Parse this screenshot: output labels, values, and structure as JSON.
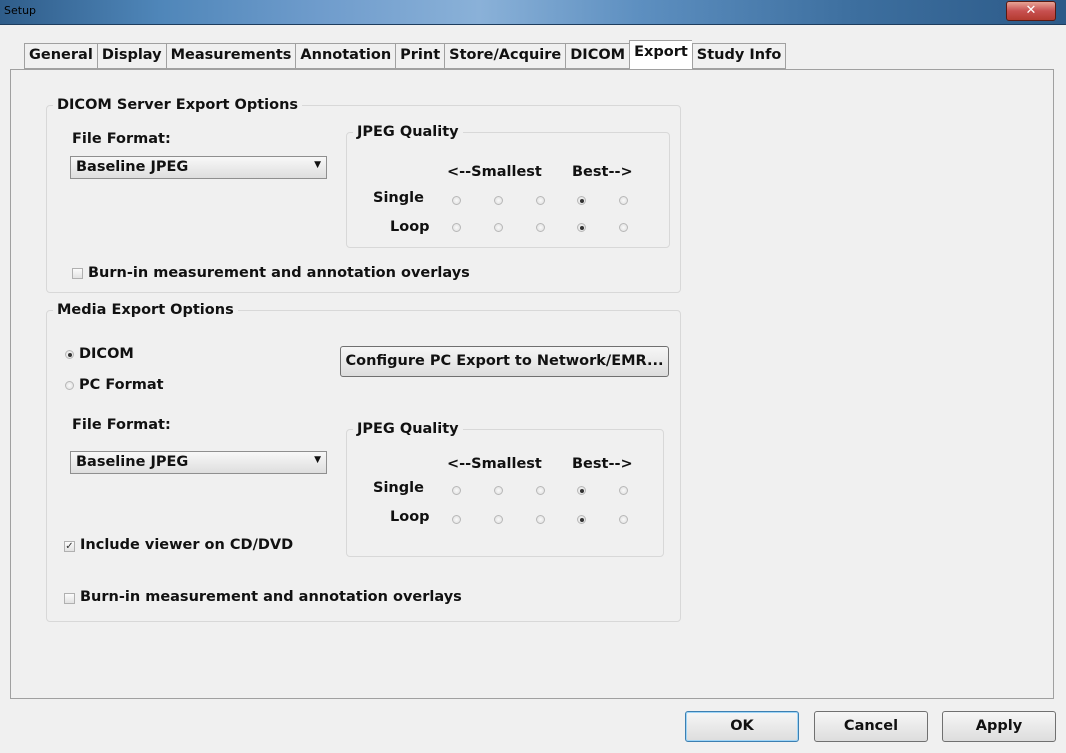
{
  "window": {
    "title": "Setup",
    "close_glyph": "✕"
  },
  "tabs": [
    "General",
    "Display",
    "Measurements",
    "Annotation",
    "Print",
    "Store/Acquire",
    "DICOM",
    "Export",
    "Study Info"
  ],
  "active_tab": "Export",
  "server_group": {
    "title": "DICOM Server Export Options",
    "file_format_label": "File Format:",
    "file_format_value": "Baseline JPEG",
    "jpeg": {
      "title": "JPEG Quality",
      "smallest_label": "<--Smallest",
      "best_label": "Best-->",
      "single_label": "Single",
      "loop_label": "Loop",
      "single_selected": 4,
      "loop_selected": 4
    },
    "burn_in_label": "Burn-in measurement and annotation overlays",
    "burn_in_checked": false
  },
  "media_group": {
    "title": "Media Export Options",
    "dicom_label": "DICOM",
    "pc_format_label": "PC Format",
    "selected_format": "DICOM",
    "configure_button": "Configure PC Export to Network/EMR...",
    "file_format_label": "File Format:",
    "file_format_value": "Baseline JPEG",
    "jpeg": {
      "title": "JPEG Quality",
      "smallest_label": "<--Smallest",
      "best_label": "Best-->",
      "single_label": "Single",
      "loop_label": "Loop",
      "single_selected": 4,
      "loop_selected": 4
    },
    "include_viewer_label": "Include viewer on CD/DVD",
    "include_viewer_checked": true,
    "burn_in_label": "Burn-in measurement and annotation overlays",
    "burn_in_checked": false
  },
  "buttons": {
    "ok": "OK",
    "cancel": "Cancel",
    "apply": "Apply"
  },
  "icons": {
    "dropdown": "chevron-down-icon",
    "check": "check-icon",
    "close": "close-icon"
  }
}
